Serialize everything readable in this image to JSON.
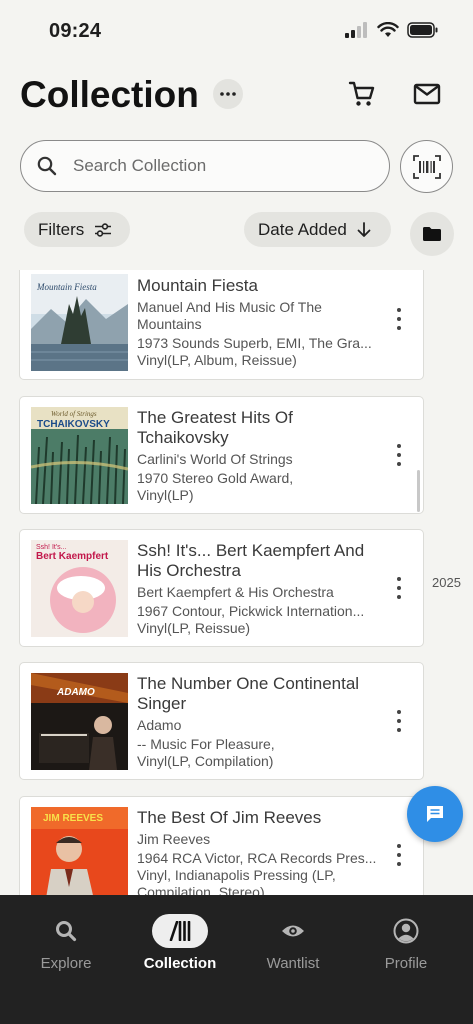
{
  "status_bar": {
    "time": "09:24"
  },
  "header": {
    "title": "Collection",
    "search_placeholder": "Search Collection",
    "filters_label": "Filters",
    "sort_label": "Date Added"
  },
  "releases": [
    {
      "title": "Mountain Fiesta",
      "artist": "Manuel And His Music Of The Mountains",
      "label": "1973 Sounds Superb, EMI, The Gra...",
      "format": "Vinyl(LP, Album, Reissue)",
      "cover_text": "Mountain Fiesta"
    },
    {
      "title": "The Greatest Hits Of Tchaikovsky",
      "artist": "Carlini's World Of Strings",
      "label": "1970 Stereo Gold Award,",
      "format": "Vinyl(LP)",
      "cover_text": "TCHAIKOVSKY"
    },
    {
      "title": "Ssh! It's... Bert Kaempfert And His Orchestra",
      "artist": "Bert Kaempfert & His Orchestra",
      "label": "1967 Contour, Pickwick Internation...",
      "format": "Vinyl(LP, Reissue)",
      "cover_text": "Bert Kaempfert"
    },
    {
      "title": "The Number One Continental Singer",
      "artist": "Adamo",
      "label": "-- Music For Pleasure,",
      "format": "Vinyl(LP, Compilation)",
      "cover_text": "ADAMO"
    },
    {
      "title": "The Best Of Jim Reeves",
      "artist": "Jim Reeves",
      "label": "1964 RCA Victor, RCA Records Pres...",
      "format": "Vinyl, Indianapolis Pressing (LP, Compilation, Stereo)",
      "cover_text": "JIM REEVES"
    }
  ],
  "scroll_year": "2025",
  "tabs": [
    {
      "label": "Explore",
      "icon": "search-icon"
    },
    {
      "label": "Collection",
      "icon": "collection-icon",
      "active": true
    },
    {
      "label": "Wantlist",
      "icon": "eye-icon"
    },
    {
      "label": "Profile",
      "icon": "profile-icon"
    }
  ],
  "colors": {
    "accent": "#2f8ee6",
    "tabbar": "#222222",
    "background": "#f4f4f1"
  }
}
